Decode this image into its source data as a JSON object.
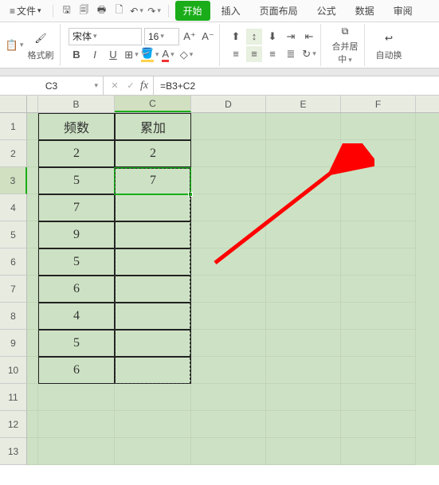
{
  "menu": {
    "file": "文件",
    "tabs": [
      "开始",
      "插入",
      "页面布局",
      "公式",
      "数据",
      "审阅"
    ]
  },
  "ribbon": {
    "format_painter": "格式刷",
    "font_name": "宋体",
    "font_size": "16",
    "merge_center": "合并居中",
    "auto_wrap": "自动换"
  },
  "formula_bar": {
    "cell_ref": "C3",
    "formula": "=B3+C2"
  },
  "columns": [
    "B",
    "C",
    "D",
    "E",
    "F"
  ],
  "row_numbers": [
    1,
    2,
    3,
    4,
    5,
    6,
    7,
    8,
    9,
    10,
    11,
    12,
    13
  ],
  "table": {
    "headers": {
      "B": "频数",
      "C": "累加"
    },
    "rows": [
      {
        "B": "2",
        "C": "2"
      },
      {
        "B": "5",
        "C": "7"
      },
      {
        "B": "7",
        "C": ""
      },
      {
        "B": "9",
        "C": ""
      },
      {
        "B": "5",
        "C": ""
      },
      {
        "B": "6",
        "C": ""
      },
      {
        "B": "4",
        "C": ""
      },
      {
        "B": "5",
        "C": ""
      },
      {
        "B": "6",
        "C": ""
      }
    ]
  },
  "selection": {
    "active": "C3",
    "fill_range": "C3:C10"
  }
}
